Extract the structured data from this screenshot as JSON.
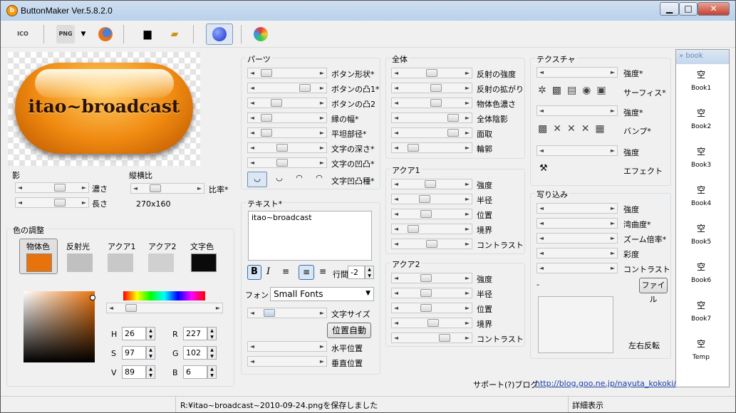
{
  "app": {
    "title": "ButtonMaker Ver.5.8.2.0",
    "icon_letter": "b"
  },
  "toolbar": {
    "ico": "ICO",
    "png": "PNG"
  },
  "preview": {
    "text": "itao~broadcast"
  },
  "shadow": {
    "title": "影",
    "density": "濃さ",
    "length": "長さ"
  },
  "aspect": {
    "title": "縦横比",
    "ratio_label": "比率*",
    "size": "270x160"
  },
  "color_adjust": {
    "title": "色の調整",
    "tabs": [
      {
        "label": "物体色",
        "color": "#e8720c"
      },
      {
        "label": "反射光",
        "color": "#c0c0c0"
      },
      {
        "label": "アクア1",
        "color": "#c8c8c8"
      },
      {
        "label": "アクア2",
        "color": "#d0d0d0"
      },
      {
        "label": "文字色",
        "color": "#0a0a0a"
      }
    ],
    "h": "26",
    "s": "97",
    "v": "89",
    "r": "227",
    "g": "102",
    "b": "6",
    "h_label": "H",
    "s_label": "S",
    "v_label": "V",
    "r_label": "R",
    "g_label": "G",
    "b_label": "B"
  },
  "parts": {
    "title": "パーツ",
    "items": [
      "ボタン形状*",
      "ボタンの凸1*",
      "ボタンの凸2",
      "縁の幅*",
      "平坦部径*",
      "文字の深さ*",
      "文字の凹凸*",
      "文字凹凸種*"
    ]
  },
  "text_panel": {
    "title": "テキスト*",
    "value": "itao~broadcast",
    "line_spacing_label": "行間",
    "line_spacing": "-2",
    "font_label": "フォント",
    "font": "Small Fonts",
    "size_label": "文字サイズ",
    "auto_pos": "位置自動",
    "h_pos": "水平位置",
    "v_pos": "垂直位置"
  },
  "overall": {
    "title": "全体",
    "items": [
      "反射の強度",
      "反射の拡がり",
      "物体色濃さ",
      "全体陰影",
      "面取",
      "輪郭"
    ]
  },
  "aqua1": {
    "title": "アクア1",
    "items": [
      "強度",
      "半径",
      "位置",
      "境界",
      "コントラスト"
    ]
  },
  "aqua2": {
    "title": "アクア2",
    "items": [
      "強度",
      "半径",
      "位置",
      "境界",
      "コントラスト"
    ]
  },
  "texture": {
    "title": "テクスチャ",
    "strength1": "強度*",
    "surface": "サーフィス*",
    "strength2": "強度*",
    "bump": "バンプ*",
    "strength3": "強度",
    "effect": "エフェクト"
  },
  "reflection": {
    "title": "写り込み",
    "items": [
      "強度",
      "湾曲度*",
      "ズーム倍率*",
      "彩度",
      "コントラスト"
    ],
    "dash": "-",
    "file": "ファイル",
    "flip": "左右反転"
  },
  "support": {
    "label": "サポート(?)ブログ",
    "url": "http://blog.goo.ne.jp/nayuta_kokoki/"
  },
  "books": {
    "header": "book",
    "items": [
      {
        "glyph": "空",
        "name": "Book1"
      },
      {
        "glyph": "空",
        "name": "Book2"
      },
      {
        "glyph": "空",
        "name": "Book3"
      },
      {
        "glyph": "空",
        "name": "Book4"
      },
      {
        "glyph": "空",
        "name": "Book5"
      },
      {
        "glyph": "空",
        "name": "Book6"
      },
      {
        "glyph": "空",
        "name": "Book7"
      },
      {
        "glyph": "空",
        "name": "Temp"
      }
    ]
  },
  "status": {
    "message": "R:¥itao~broadcast~2010-09-24.pngを保存しました",
    "detail": "詳細表示"
  }
}
